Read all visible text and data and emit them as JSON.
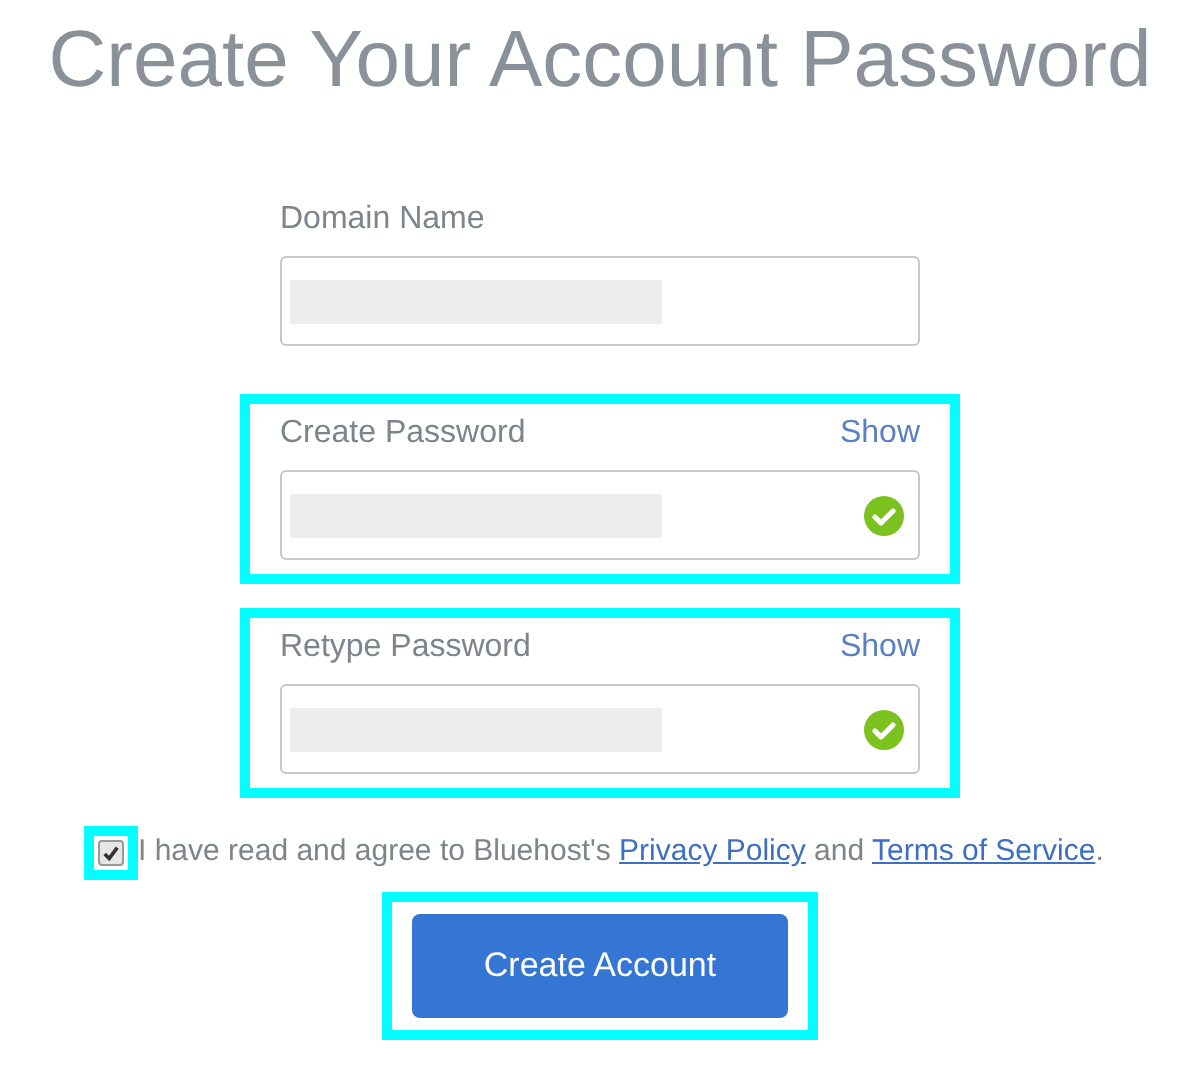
{
  "title": "Create Your Account Password",
  "fields": [
    {
      "label": "Domain Name",
      "valid": false,
      "highlighted": false
    },
    {
      "label": "Create Password",
      "show_link": "Show",
      "valid": true,
      "highlighted": true
    },
    {
      "label": "Retype Password",
      "show_link": "Show",
      "valid": true,
      "highlighted": true
    }
  ],
  "agreement": {
    "checked": true,
    "highlighted": true,
    "parts": [
      {
        "kind": "text",
        "text": "I have read and agree to Bluehost's "
      },
      {
        "kind": "link",
        "text": "Privacy Policy"
      },
      {
        "kind": "text",
        "text": " and "
      },
      {
        "kind": "link",
        "text": "Terms of Service"
      },
      {
        "kind": "text",
        "text": "."
      }
    ]
  },
  "submit": {
    "label": "Create Account",
    "highlighted": true
  }
}
